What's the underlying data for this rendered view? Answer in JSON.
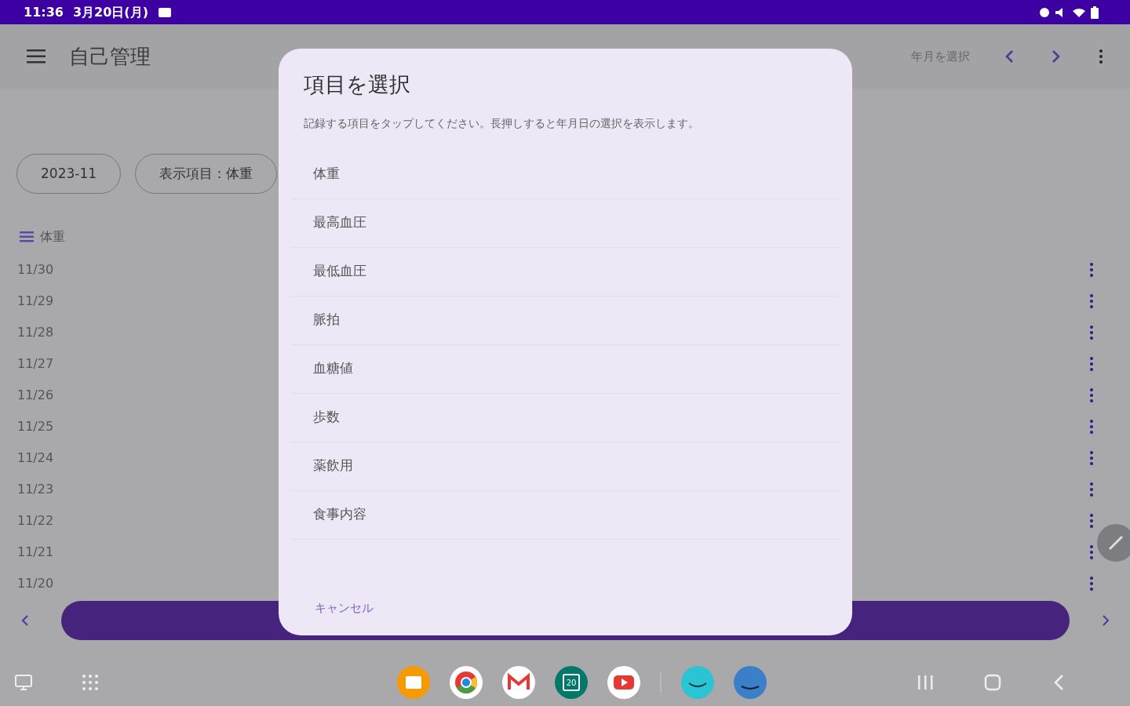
{
  "status_bar": {
    "time": "11:36",
    "date": "3月20日(月)"
  },
  "app_bar": {
    "title": "自己管理",
    "month_select": "年月を選択"
  },
  "chips": [
    {
      "label": "2023-11"
    },
    {
      "label": "表示項目：体重"
    }
  ],
  "list_header": "体重",
  "rows": [
    {
      "date": "11/30"
    },
    {
      "date": "11/29"
    },
    {
      "date": "11/28"
    },
    {
      "date": "11/27"
    },
    {
      "date": "11/26"
    },
    {
      "date": "11/25"
    },
    {
      "date": "11/24"
    },
    {
      "date": "11/23"
    },
    {
      "date": "11/22"
    },
    {
      "date": "11/21"
    },
    {
      "date": "11/20"
    }
  ],
  "dialog": {
    "title": "項目を選択",
    "message": "記録する項目をタップしてください。長押しすると年月日の選択を表示します。",
    "items": [
      "体重",
      "最高血圧",
      "最低血圧",
      "脈拍",
      "血糖値",
      "歩数",
      "薬飲用",
      "食事内容"
    ],
    "cancel": "キャンセル"
  },
  "dock": {
    "calendar_day": "20"
  }
}
